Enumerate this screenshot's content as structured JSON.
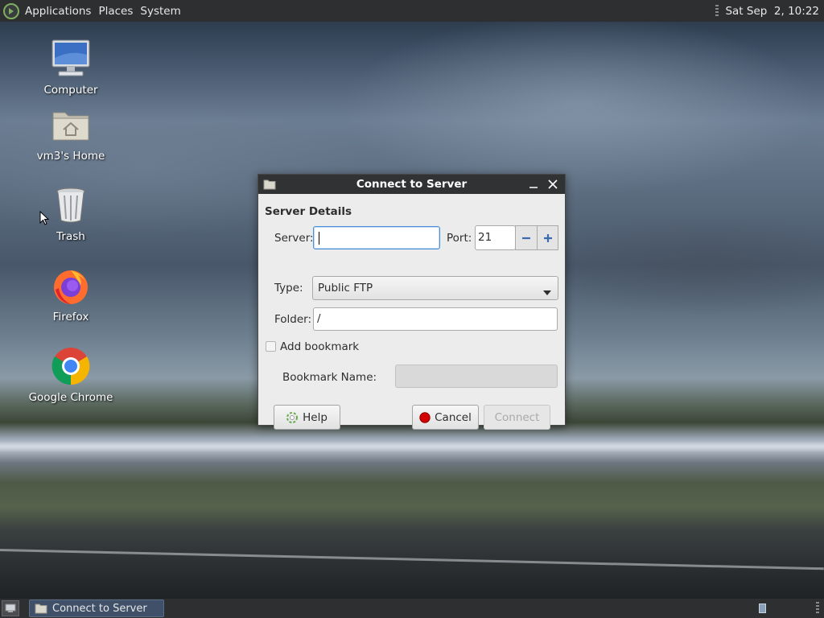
{
  "top_panel": {
    "menus": [
      "Applications",
      "Places",
      "System"
    ],
    "clock": "Sat Sep  2, 10:22"
  },
  "desktop_icons": [
    {
      "label": "Computer",
      "icon": "computer-icon"
    },
    {
      "label": "vm3's Home",
      "icon": "home-folder-icon"
    },
    {
      "label": "Trash",
      "icon": "trash-icon"
    },
    {
      "label": "Firefox",
      "icon": "firefox-icon"
    },
    {
      "label": "Google Chrome",
      "icon": "chrome-icon"
    }
  ],
  "dialog": {
    "title": "Connect to Server",
    "section_title": "Server Details",
    "server": {
      "label": "Server:",
      "value": ""
    },
    "port": {
      "label": "Port:",
      "value": "21"
    },
    "type": {
      "label": "Type:",
      "selected": "Public FTP"
    },
    "folder": {
      "label": "Folder:",
      "value": "/"
    },
    "add_bookmark": {
      "label": "Add bookmark",
      "checked": false
    },
    "bookmark_name": {
      "label": "Bookmark Name:",
      "value": "",
      "enabled": false
    },
    "buttons": {
      "help": "Help",
      "cancel": "Cancel",
      "connect": "Connect"
    }
  },
  "taskbar": {
    "task_label": "Connect to Server"
  },
  "colors": {
    "panel_bg": "#2d2f31",
    "titlebar_bg": "#303234",
    "dialog_bg": "#ececec",
    "focus_border": "#4a90d9",
    "cancel_icon": "#d40000",
    "task_active": "#3f5068"
  }
}
